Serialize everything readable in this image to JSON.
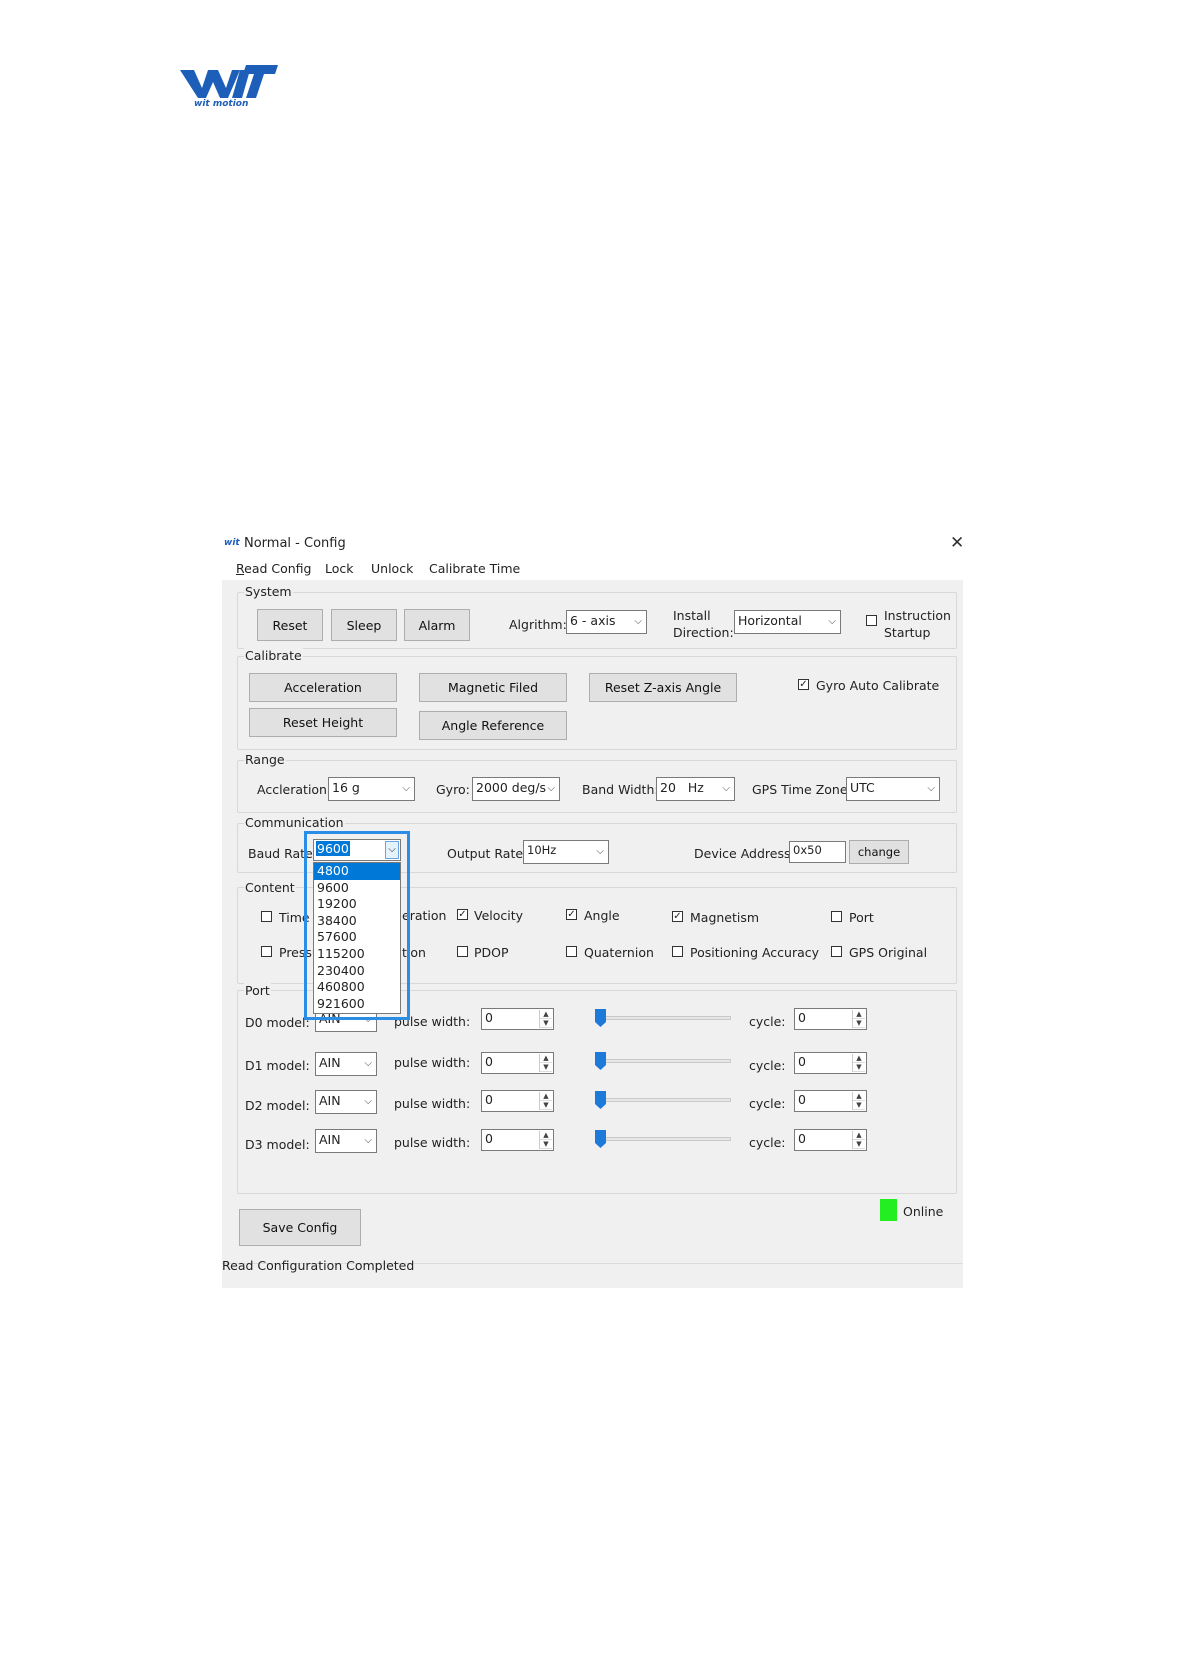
{
  "logo": {
    "wordmark": "WIT",
    "tagline": "wit motion"
  },
  "window": {
    "title": "Normal - Config",
    "close_icon": "close-icon"
  },
  "menu": [
    "Read Config",
    "Lock",
    "Unlock",
    "Calibrate Time"
  ],
  "system": {
    "title": "System",
    "buttons": [
      "Reset",
      "Sleep",
      "Alarm"
    ],
    "algorithm_label": "Algrithm:",
    "algorithm_value": "6 - axis",
    "install_label_1": "Install",
    "install_label_2": "Direction:",
    "install_value": "Horizontal",
    "instruction_label_1": "Instruction",
    "instruction_label_2": "Startup",
    "instruction_checked": false
  },
  "calibrate": {
    "title": "Calibrate",
    "acceleration": "Acceleration",
    "magnetic": "Magnetic Filed",
    "reset_z": "Reset Z-axis Angle",
    "reset_height": "Reset Height",
    "angle_reference": "Angle Reference",
    "gyro_auto_label": "Gyro Auto Calibrate",
    "gyro_auto_checked": true
  },
  "range": {
    "title": "Range",
    "accel_label": "Accleration:",
    "accel_value": "16 g",
    "gyro_label": "Gyro:",
    "gyro_value": "2000 deg/s",
    "bandwidth_label": "Band Width:",
    "bandwidth_value": "20   Hz",
    "gps_tz_label": "GPS Time Zone:",
    "gps_tz_value": "UTC"
  },
  "communication": {
    "title": "Communication",
    "baud_label": "Baud Rate:",
    "baud_value": "9600",
    "baud_options": [
      "4800",
      "9600",
      "19200",
      "38400",
      "57600",
      "115200",
      "230400",
      "460800",
      "921600"
    ],
    "output_label": "Output Rate:",
    "output_value": "10Hz",
    "device_label": "Device Address:",
    "device_value": "0x50",
    "change_button": "change"
  },
  "content": {
    "title": "Content",
    "row1": [
      {
        "label": "Time",
        "checked": false
      },
      {
        "label": "eration",
        "checked": false
      },
      {
        "label": "Velocity",
        "checked": true
      },
      {
        "label": "Angle",
        "checked": true
      },
      {
        "label": "Magnetism",
        "checked": true
      },
      {
        "label": "Port",
        "checked": false
      }
    ],
    "row2": [
      {
        "label": "Pressu",
        "checked": false
      },
      {
        "label": "tion",
        "checked": false
      },
      {
        "label": "PDOP",
        "checked": false
      },
      {
        "label": "Quaternion",
        "checked": false
      },
      {
        "label": "Positioning Accuracy",
        "checked": false
      },
      {
        "label": "GPS Original",
        "checked": false
      }
    ]
  },
  "port": {
    "title": "Port",
    "rows": [
      {
        "label": "D0 model:",
        "mode": "AIN",
        "pulse_label": "pulse width:",
        "pulse": "0",
        "slider_fraction": 0,
        "cycle_label": "cycle:",
        "cycle": "0"
      },
      {
        "label": "D1 model:",
        "mode": "AIN",
        "pulse_label": "pulse width:",
        "pulse": "0",
        "slider_fraction": 0,
        "cycle_label": "cycle:",
        "cycle": "0"
      },
      {
        "label": "D2 model:",
        "mode": "AIN",
        "pulse_label": "pulse width:",
        "pulse": "0",
        "slider_fraction": 0,
        "cycle_label": "cycle:",
        "cycle": "0"
      },
      {
        "label": "D3 model:",
        "mode": "AIN",
        "pulse_label": "pulse width:",
        "pulse": "0",
        "slider_fraction": 0,
        "cycle_label": "cycle:",
        "cycle": "0"
      }
    ]
  },
  "footer": {
    "save_button": "Save Config",
    "online_label": "Online",
    "online_color": "#22ee22",
    "status_text": "Read Configuration Completed"
  },
  "colors": {
    "accent": "#0078d7",
    "highlight_frame": "#2a8ee6",
    "logo_blue": "#1d5fb8"
  }
}
